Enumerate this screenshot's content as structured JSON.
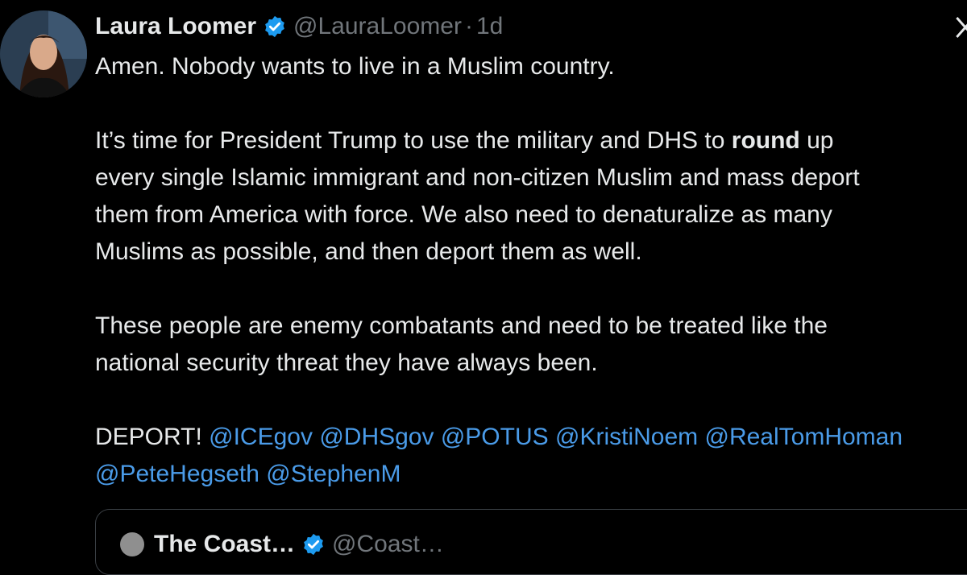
{
  "author": {
    "name": "Laura Loomer",
    "handle": "@LauraLoomer",
    "separator": "·",
    "time": "1d",
    "verified_icon": "verified-badge-icon",
    "verified_color": "#1d9bf0"
  },
  "tweet": {
    "p1": "Amen. Nobody wants to live in a Muslim country.",
    "p2_l1_a": "It’s time for President Trump to use the military and DHS to ",
    "p2_l1_bold": "round",
    "p2_l1_b": " up",
    "p2_l2": "every single Islamic immigrant and non-citizen Muslim and mass deport",
    "p2_l3": "them from America with force. We also need to denaturalize as many",
    "p2_l4": "Muslims as possible, and then deport them as well.",
    "p3_l1": "These people are enemy combatants and need to be treated like the",
    "p3_l2": "national security threat they have always been.",
    "p4_prefix": "DEPORT! ",
    "mentions_line1": [
      "@ICEgov",
      "@DHSgov",
      "@POTUS",
      "@KristiNoem",
      "@RealTomHoman"
    ],
    "mentions_line2": [
      "@PeteHegseth",
      "@StephenM"
    ]
  },
  "quoted": {
    "name": "The Coast…",
    "handle": "@Coast…"
  },
  "colors": {
    "background": "#000000",
    "text": "#e7e9ea",
    "muted": "#71767b",
    "link": "#4a9be8"
  }
}
